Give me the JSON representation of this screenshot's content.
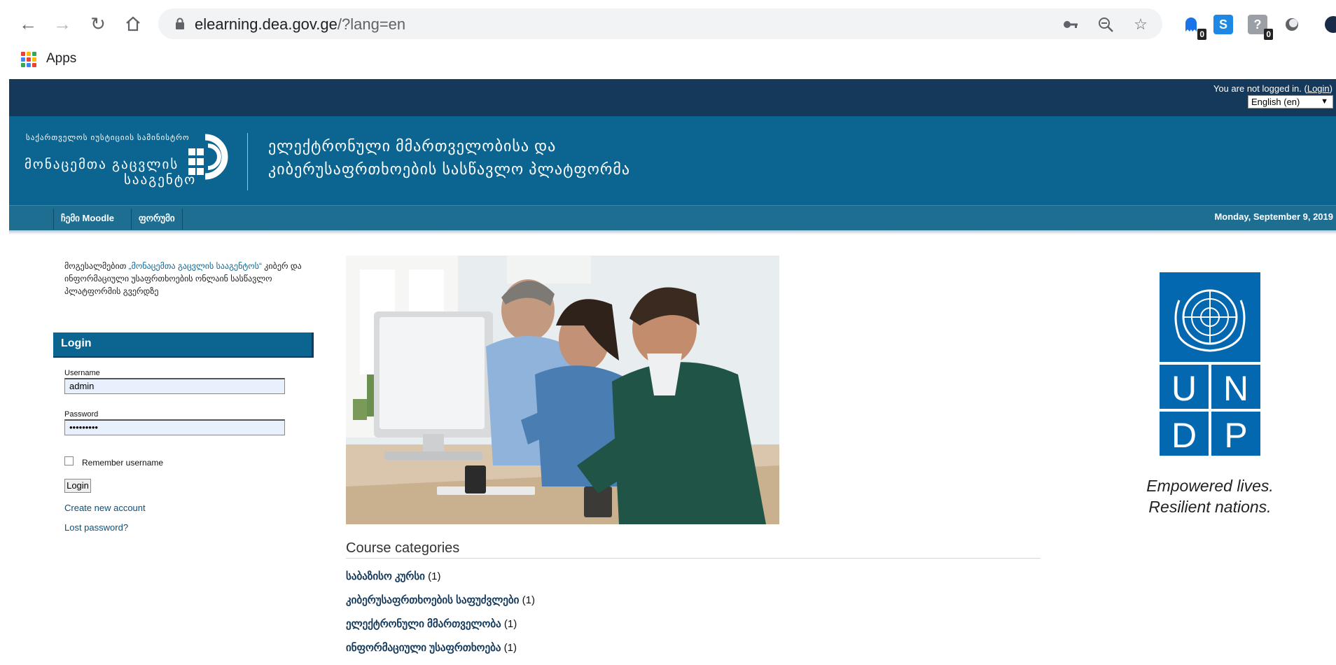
{
  "browser": {
    "url_host": "elearning.dea.gov.ge",
    "url_path": "/?lang=en",
    "bookmarks": [
      {
        "label": "Apps"
      }
    ],
    "extensions": [
      {
        "name": "ghost-extension-icon",
        "badge": "0",
        "color": "#1a73e8"
      },
      {
        "name": "s-extension-icon",
        "letter": "S",
        "color": "#1e88e5"
      },
      {
        "name": "question-extension-icon",
        "badge": "0",
        "color": "#9aa0a6"
      },
      {
        "name": "circle-extension-icon",
        "color": "#5f6368"
      }
    ]
  },
  "topbar": {
    "login_prefix": "You are not logged in. (",
    "login_link": "Login",
    "login_suffix": ")",
    "language": "English (en)"
  },
  "header": {
    "org_small": "საქართველოს იუსტიციის სამინისტრო",
    "org_big_1": "მონაცემთა გაცვლის",
    "org_big_2": "სააგენტო",
    "platform_title_1": "ელექტრონული მმართველობისა და",
    "platform_title_2": "კიბერუსაფრთხოების სასწავლო პლატფორმა"
  },
  "navbar": {
    "items": [
      {
        "label": "ჩემი Moodle"
      },
      {
        "label": "ფორუმი"
      }
    ],
    "date": "Monday, September 9, 2019"
  },
  "welcome": {
    "prefix": "მოგესალმებით ",
    "highlight": "„მონაცემთა გაცვლის სააგენტოს“",
    "rest": " კიბერ და ინფორმაციული უსაფრთხოების ონლაინ სასწავლო პლატფორმის გვერდზე"
  },
  "login": {
    "title": "Login",
    "username_label": "Username",
    "username_value": "admin",
    "password_label": "Password",
    "password_value": "•••••••••",
    "remember_label": "Remember username",
    "remember_checked": false,
    "button_label": "Login",
    "create_account": "Create new account",
    "lost_password": "Lost password?"
  },
  "categories": {
    "title": "Course categories",
    "items": [
      {
        "name": "საბაზისო კურსი",
        "count": "(1)"
      },
      {
        "name": "კიბერუსაფრთხოების საფუძვლები",
        "count": "(1)"
      },
      {
        "name": "ელექტრონული მმართველობა",
        "count": "(1)"
      },
      {
        "name": "ინფორმაციული უსაფრთხოება",
        "count": "(1)"
      }
    ]
  },
  "undp": {
    "letters": [
      "U",
      "N",
      "D",
      "P"
    ],
    "tagline_1": "Empowered lives.",
    "tagline_2": "Resilient nations.",
    "color": "#0468b1"
  },
  "colors": {
    "topbar": "#15395a",
    "header": "#0c6590",
    "navbar": "#1e6e92"
  }
}
